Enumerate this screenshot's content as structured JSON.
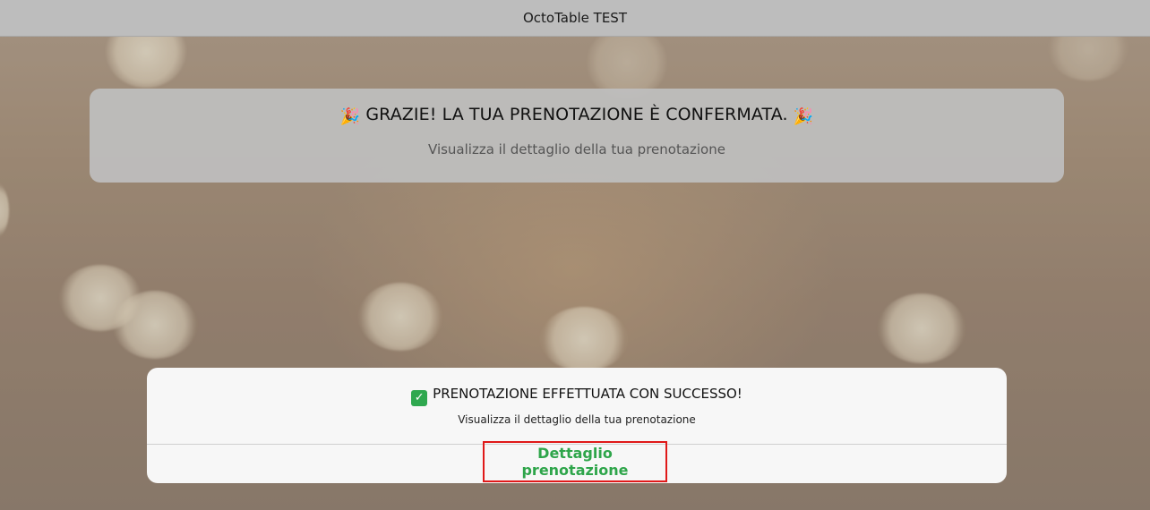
{
  "window": {
    "title": "OctoTable TEST"
  },
  "banner": {
    "title": "GRAZIE! LA TUA PRENOTAZIONE È CONFERMATA.",
    "emoji_left": "🎉",
    "emoji_right": "🎉",
    "subtitle": "Visualizza il dettaglio della tua prenotazione"
  },
  "modal": {
    "icon": "check-mark-button-icon",
    "title": "PRENOTAZIONE EFFETTUATA CON SUCCESSO!",
    "subtitle": "Visualizza il dettaglio della tua prenotazione",
    "action_label": "Dettaglio prenotazione"
  },
  "colors": {
    "accent_green": "#2ea54a",
    "highlight_red": "#e01919"
  }
}
